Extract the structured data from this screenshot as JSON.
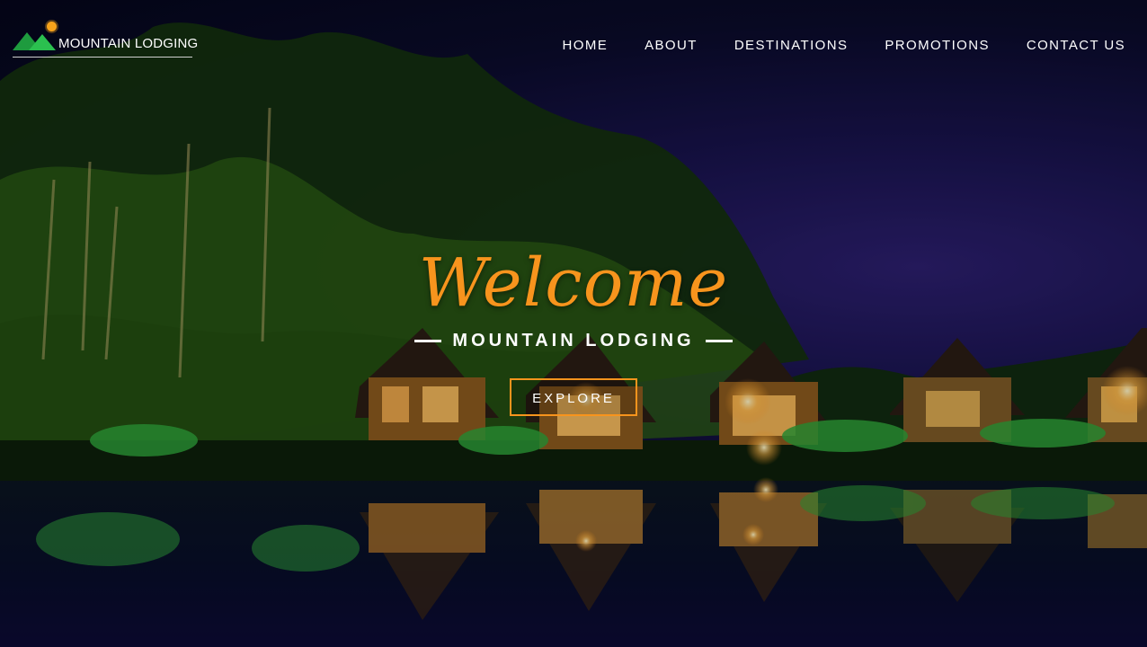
{
  "brand": {
    "name": "MOUNTAIN LODGING"
  },
  "nav": {
    "items": [
      {
        "label": "HOME"
      },
      {
        "label": "ABOUT"
      },
      {
        "label": "DESTINATIONS"
      },
      {
        "label": "PROMOTIONS"
      },
      {
        "label": "CONTACT US"
      }
    ]
  },
  "hero": {
    "welcome": "Welcome",
    "subtitle": "MOUNTAIN LODGING",
    "cta_label": "EXPLORE"
  },
  "colors": {
    "accent": "#f7941d",
    "logo_green": "#2bc04f",
    "logo_sun": "#f7a21b"
  },
  "background": {
    "icon": "night-lakeside-cabins-photo"
  }
}
